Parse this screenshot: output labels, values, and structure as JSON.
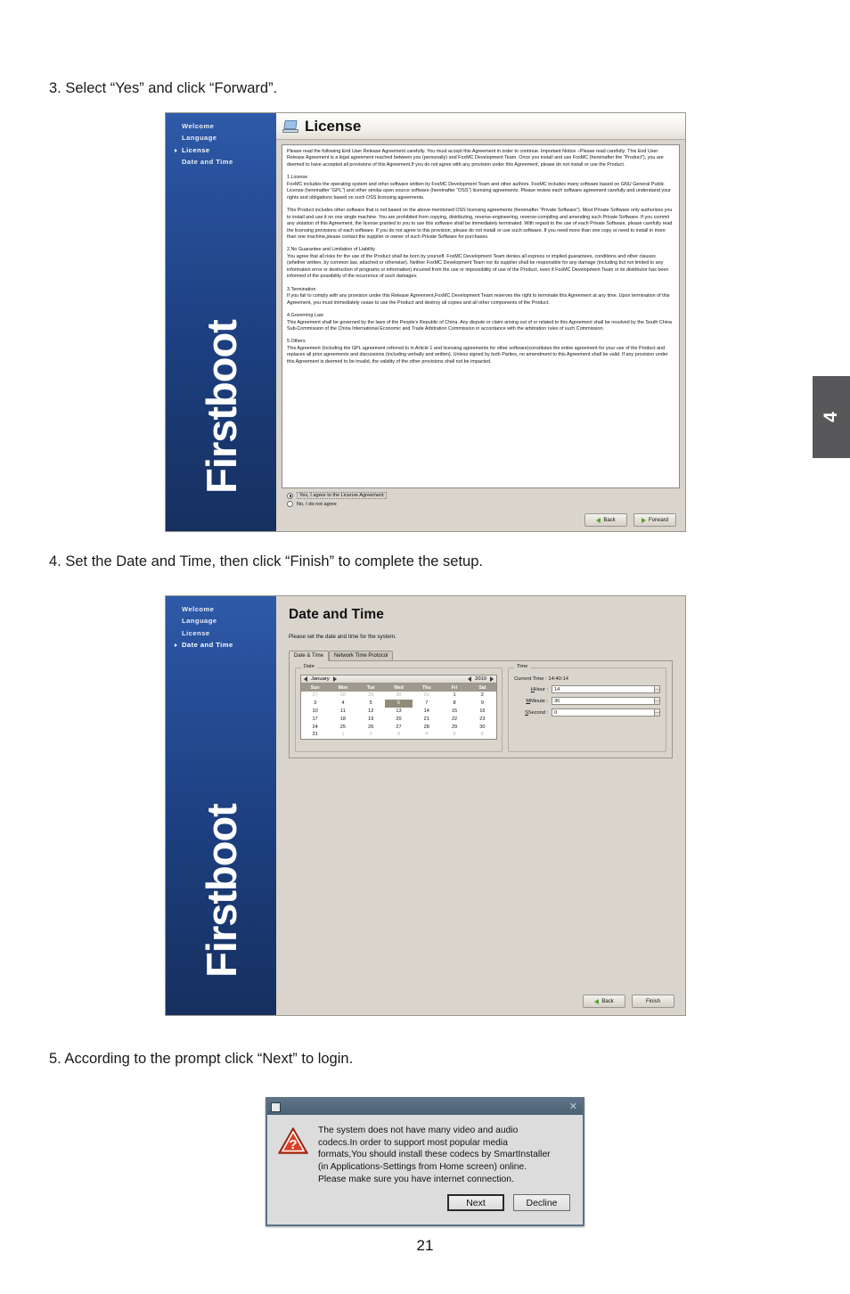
{
  "page": {
    "number": "21",
    "side_tab_label": "4",
    "steps": {
      "step3": "3. Select “Yes” and click “Forward”.",
      "step4": "4. Set the Date and Time, then click “Finish” to complete the setup.",
      "step5": "5. According to the prompt click “Next” to login."
    }
  },
  "firstboot": {
    "brand": "Firstboot",
    "nav": [
      {
        "label": "Welcome",
        "selected": false
      },
      {
        "label": "Language",
        "selected": false
      },
      {
        "label": "License",
        "selected": true
      },
      {
        "label": "Date and Time",
        "selected": false
      }
    ],
    "nav2": [
      {
        "label": "Welcome",
        "selected": false
      },
      {
        "label": "Language",
        "selected": false
      },
      {
        "label": "License",
        "selected": false
      },
      {
        "label": "Date and Time",
        "selected": true
      }
    ]
  },
  "license": {
    "title": "License",
    "icon": "computer-icon",
    "paragraphs": [
      "Please read the following End User Release Agreement carefully.  You must accept this Agreement in order to continue.  Important Notice –Please read carefully: This End User Release Agreement is a legal agreement reached between you (personally) and FoxMC Development Team. Once you install and use FoxMC (hereinafter the “Product”), you are deemed to have accepted all provisions of this Agreement.If you do not agree with any provision under this Agreement, please do not install or use the Product.",
      "1.License",
      "FoxMC includes the operating system and other software written by FoxMC Development Team and other authors. FoxMC includes many software based on GNU General Public License (hereinafter “GPL”) and other similar open source software (hereinafter “OSS”) licensing agreements. Please review each software agreement carefully and understand your rights and obligations based on such OSS licensing agreements.",
      "This Product includes other software that is not based on the above-mentioned OSS licensing  agreements (hereinafter “Private Software”).  Most Private Software only authorizes you to install and use it on one single machine. You are prohibited from copying, distributing, reverse-engineering, reverse-compiling and amending such Private Software.  If you commit any violation of this Agreement, the license granted to you to use this software shall be immediately terminated.  With regard to the use of each Private Software, please carefully read the licensing provisions of each software.  If you do not agree to this provision, please do not install or use such software. If you need more than one copy or need to install in more than one machine,please contact the supplier or owner of such Private Software for purchases.",
      "2.No Guarantee and Limitation of Liability",
      "You agree that all risks for the use of the Product shall be born by yourself. FoxMC Development Team denies all express or implied guarantees, conditions and other clauses (whether written, by common law, attached or otherwise).  Neither FoxMC Development Team nor its supplier shall be responsible for any damage (including but not limited to any information error or destruction of programs or information) incurred from the use or impossibility of use of the Product, even if FoxMC Development Team or its distributor has been informed of the possibility of the incurrence of such damages.",
      "3.Termination",
      "If you fail to comply with any provision under this Release Agreement,FoxMC Development Team reserves the right to terminate this Agreement at any time. Upon termination of this Agreement, you must immediately cease to use the Product and destroy all copies and all other components of the Product.",
      "4.Governing Law",
      "This Agreement shall be governed by the laws of the People’s Republic of China. Any dispute or claim arising out of or related to this Agreement shall be resolved by the South China Sub-Commission of the China International Economic and Trade Arbitration Commission in accordance with the arbitration rules of such Commission.",
      "5.Others",
      "This Agreement (including the GPL agreement referred to in Article 1 and licensing agreements for other software)constitutes the entire agreement for your use of the Product and replaces all prior agreements and discussions (including verbally and written).  Unless signed by both Parties, no amendment to this Agreement shall be valid.  If any provision under this Agreement is deemed to be invalid, the validity of the other provisions shall not be impacted."
    ],
    "options": [
      {
        "label": "Yes, I agree to the License Agreement",
        "selected": true
      },
      {
        "label": "No, I do not agree",
        "selected": false
      }
    ],
    "buttons": {
      "back": "Back",
      "forward": "Forward"
    }
  },
  "datetime": {
    "title": "Date and Time",
    "subtitle": "Please set the date and time for the system.",
    "tabs": [
      {
        "label": "Date & Time",
        "active": true
      },
      {
        "label": "Network Time Protocol",
        "active": false
      }
    ],
    "date_group_legend": "Date",
    "time_group_legend": "Time",
    "calendar": {
      "month": "January",
      "year": "2010",
      "weekdays": [
        "Sun",
        "Mon",
        "Tue",
        "Wed",
        "Thu",
        "Fri",
        "Sat"
      ],
      "selected_day": 6,
      "weeks": [
        [
          {
            "d": "27",
            "dim": true
          },
          {
            "d": "28",
            "dim": true
          },
          {
            "d": "29",
            "dim": true
          },
          {
            "d": "30",
            "dim": true
          },
          {
            "d": "31",
            "dim": true
          },
          {
            "d": "1"
          },
          {
            "d": "2"
          }
        ],
        [
          {
            "d": "3"
          },
          {
            "d": "4"
          },
          {
            "d": "5"
          },
          {
            "d": "6",
            "sel": true
          },
          {
            "d": "7"
          },
          {
            "d": "8"
          },
          {
            "d": "9"
          }
        ],
        [
          {
            "d": "10"
          },
          {
            "d": "11"
          },
          {
            "d": "12"
          },
          {
            "d": "13"
          },
          {
            "d": "14"
          },
          {
            "d": "15"
          },
          {
            "d": "16"
          }
        ],
        [
          {
            "d": "17"
          },
          {
            "d": "18"
          },
          {
            "d": "19"
          },
          {
            "d": "20"
          },
          {
            "d": "21"
          },
          {
            "d": "22"
          },
          {
            "d": "23"
          }
        ],
        [
          {
            "d": "24"
          },
          {
            "d": "25"
          },
          {
            "d": "26"
          },
          {
            "d": "27"
          },
          {
            "d": "28"
          },
          {
            "d": "29"
          },
          {
            "d": "30"
          }
        ],
        [
          {
            "d": "31"
          },
          {
            "d": "1",
            "dim": true
          },
          {
            "d": "2",
            "dim": true
          },
          {
            "d": "3",
            "dim": true
          },
          {
            "d": "4",
            "dim": true
          },
          {
            "d": "5",
            "dim": true
          },
          {
            "d": "6",
            "dim": true
          }
        ]
      ]
    },
    "time": {
      "current_time_label": "Current Time :",
      "current_time_value": "14:40:14",
      "hour_label": "Hour :",
      "hour_value": "14",
      "minute_label": "Minute :",
      "minute_value": "36",
      "second_label": "Second :",
      "second_value": "0"
    },
    "buttons": {
      "back": "Back",
      "finish": "Finish"
    }
  },
  "codec_dialog": {
    "title": "",
    "close_icon": "close-icon",
    "warning_icon": "warning-question-icon",
    "message_lines": [
      "The system does not have many video and audio",
      "codecs.In order to support most popular media",
      "formats,You should install these codecs by SmartInstaller",
      "(in Applications-Settings from Home screen) online.",
      "Please make sure you have internet connection."
    ],
    "buttons": {
      "next": "Next",
      "decline": "Decline"
    }
  }
}
